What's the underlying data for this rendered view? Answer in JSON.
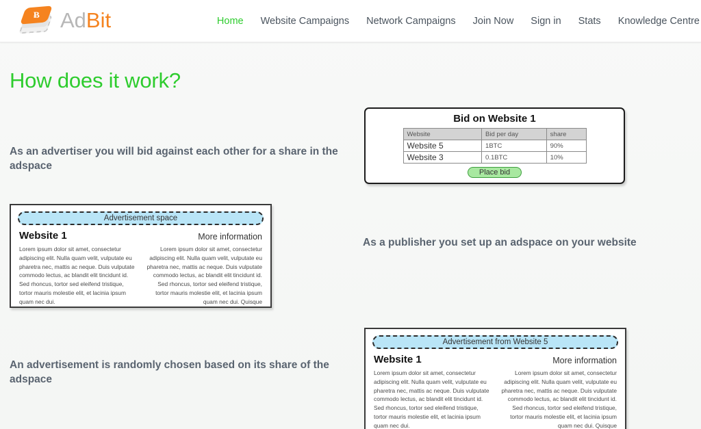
{
  "header": {
    "logo": {
      "icon": "adbit-card-logo-icon",
      "bitcoin_symbol": "Ƀ",
      "text_first": "Ad",
      "text_second": "Bit"
    },
    "nav": [
      {
        "label": "Home",
        "active": true
      },
      {
        "label": "Website Campaigns",
        "active": false
      },
      {
        "label": "Network Campaigns",
        "active": false
      },
      {
        "label": "Join Now",
        "active": false
      },
      {
        "label": "Sign in",
        "active": false
      },
      {
        "label": "Stats",
        "active": false
      },
      {
        "label": "Knowledge Centre",
        "active": false
      }
    ]
  },
  "page": {
    "title": "How does it work?"
  },
  "steps": {
    "advertiser_text": "As an advertiser you will bid against each other for a share in the adspace",
    "publisher_text": "As a publisher you set up an adspace on your website",
    "random_text": "An advertisement is randomly chosen based on its share of the adspace"
  },
  "bid_panel": {
    "title": "Bid on Website 1",
    "columns": [
      "Website",
      "Bid per day",
      "share"
    ],
    "rows": [
      {
        "website": "Website 5",
        "bid_per_day": "1BTC",
        "share": "90%"
      },
      {
        "website": "Website 3",
        "bid_per_day": "0.1BTC",
        "share": "10%"
      }
    ],
    "button_label": "Place bid"
  },
  "mock_publisher": {
    "adspace_label": "Advertisement space",
    "site_name": "Website 1",
    "more_info": "More information",
    "column_left": "Lorem ipsum dolor sit amet, consectetur adipiscing elit. Nulla quam velit, vulputate eu pharetra nec, mattis ac neque. Duis vulputate commodo lectus, ac blandit elit tincidunt id. Sed rhoncus, tortor sed eleifend tristique, tortor mauris molestie elit, et lacinia ipsum quam nec dui.",
    "column_right": "Lorem ipsum dolor sit amet, consectetur adipiscing elit. Nulla quam velit, vulputate eu pharetra nec, mattis ac neque. Duis vulputate commodo lectus, ac blandit elit tincidunt id. Sed rhoncus, tortor sed eleifend tristique, tortor mauris molestie elit, et lacinia ipsum quam nec dui. Quisque"
  },
  "mock_random": {
    "adspace_label": "Advertisement from Website 5",
    "site_name": "Website 1",
    "more_info": "More information",
    "column_left": "Lorem ipsum dolor sit amet, consectetur adipiscing elit. Nulla quam velit, vulputate eu pharetra nec, mattis ac neque. Duis vulputate commodo lectus, ac blandit elit tincidunt id. Sed rhoncus, tortor sed eleifend tristique, tortor mauris molestie elit, et lacinia ipsum quam nec dui.",
    "column_right": "Lorem ipsum dolor sit amet, consectetur adipiscing elit. Nulla quam velit, vulputate eu pharetra nec, mattis ac neque. Duis vulputate commodo lectus, ac blandit elit tincidunt id. Sed rhoncus, tortor sed eleifend tristique, tortor mauris molestie elit, et lacinia ipsum quam nec dui. Quisque"
  },
  "colors": {
    "brand_orange": "#f5831f",
    "accent_green": "#2ecc2e",
    "adspace_blue": "#b9e5f7",
    "button_green": "#a8e8a0",
    "text_gray": "#5a6470",
    "page_bg": "#f7f8f7"
  }
}
